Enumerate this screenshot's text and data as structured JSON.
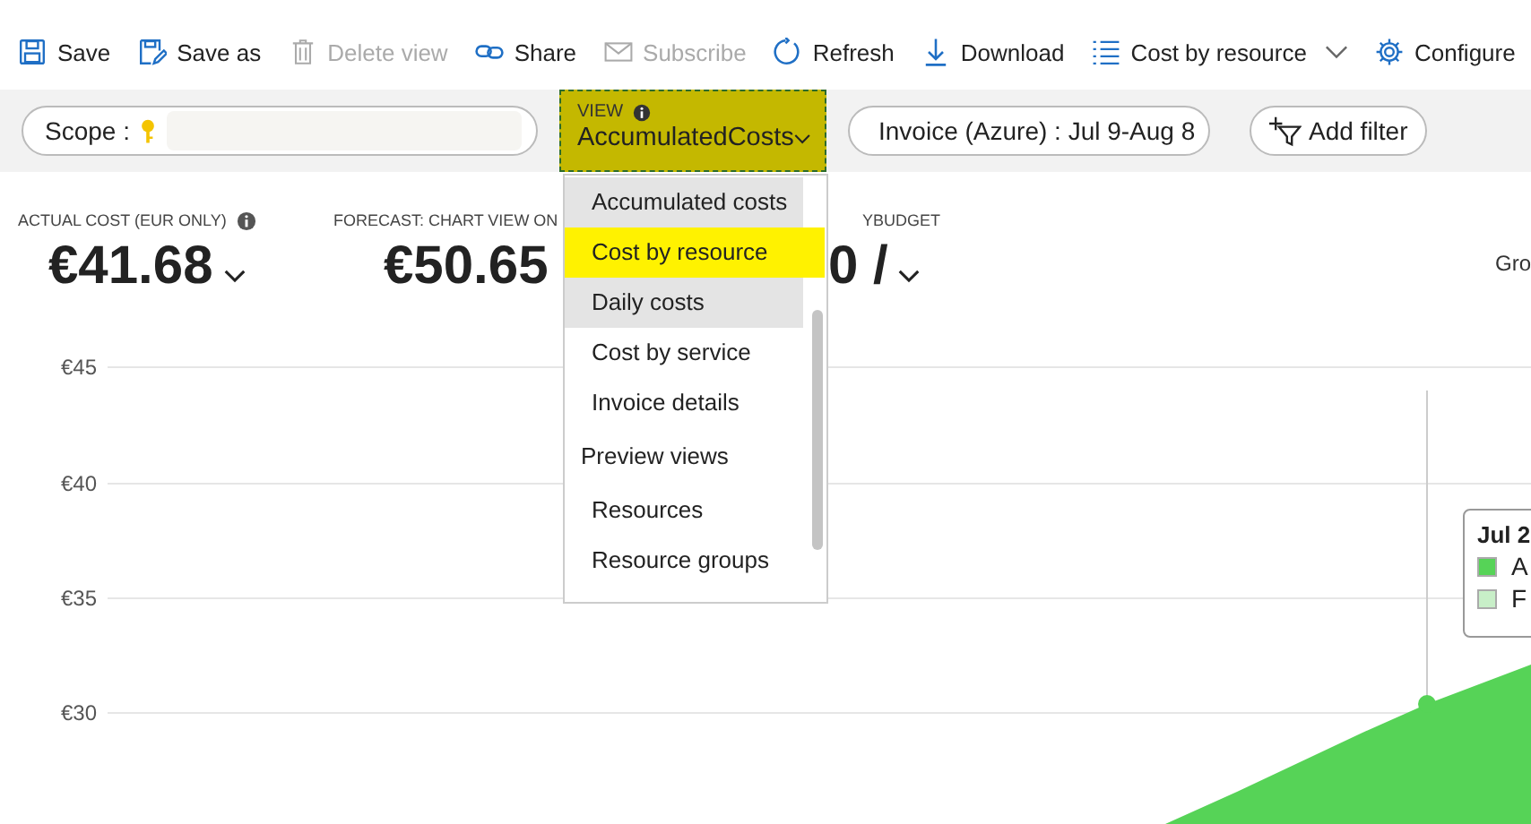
{
  "toolbar": [
    {
      "kind": "save",
      "label": "Save",
      "disabled": false,
      "dropdown": false
    },
    {
      "kind": "save-as",
      "label": "Save as",
      "disabled": false,
      "dropdown": false
    },
    {
      "kind": "delete",
      "label": "Delete view",
      "disabled": true,
      "dropdown": false
    },
    {
      "kind": "share",
      "label": "Share",
      "disabled": false,
      "dropdown": false
    },
    {
      "kind": "mail",
      "label": "Subscribe",
      "disabled": true,
      "dropdown": false
    },
    {
      "kind": "refresh",
      "label": "Refresh",
      "disabled": false,
      "dropdown": false
    },
    {
      "kind": "download",
      "label": "Download",
      "disabled": false,
      "dropdown": false
    },
    {
      "kind": "list",
      "label": "Cost by resource",
      "disabled": false,
      "dropdown": true
    },
    {
      "kind": "gear",
      "label": "Configure",
      "disabled": false,
      "dropdown": false
    }
  ],
  "filters": {
    "scope_label": "Scope :",
    "view": {
      "label": "VIEW",
      "value": "AccumulatedCosts",
      "expanded": true
    },
    "date_range": "Invoice (Azure) : Jul 9-Aug 8",
    "add_filter": "Add filter"
  },
  "kpis": [
    {
      "label": "ACTUAL COST (EUR ONLY)",
      "value": "€41.68",
      "info": true
    },
    {
      "label": "FORECAST: CHART VIEW ON",
      "value": "€50.65",
      "info": false
    },
    {
      "label": "YBUDGET",
      "value": "0 /",
      "info": false
    }
  ],
  "group_label": "Gro",
  "view_menu": [
    {
      "kind": "item",
      "label": "Accumulated costs",
      "selected": false,
      "hovered": true
    },
    {
      "kind": "item",
      "label": "Cost by resource",
      "selected": true,
      "hovered": false
    },
    {
      "kind": "item",
      "label": "Daily costs",
      "selected": false,
      "hovered": true
    },
    {
      "kind": "item",
      "label": "Cost by service",
      "selected": false,
      "hovered": false
    },
    {
      "kind": "item",
      "label": "Invoice details",
      "selected": false,
      "hovered": false
    },
    {
      "kind": "header",
      "label": "Preview views"
    },
    {
      "kind": "item",
      "label": "Resources",
      "selected": false,
      "hovered": false
    },
    {
      "kind": "item",
      "label": "Resource groups",
      "selected": false,
      "hovered": false
    }
  ],
  "chart": {
    "y_labels": [
      "€45",
      "€40",
      "€35",
      "€30"
    ],
    "tooltip": {
      "title": "Jul 2",
      "series": [
        {
          "label": "A",
          "color": "#56d357"
        },
        {
          "label": "F",
          "color": "#c8efc8"
        }
      ]
    }
  }
}
